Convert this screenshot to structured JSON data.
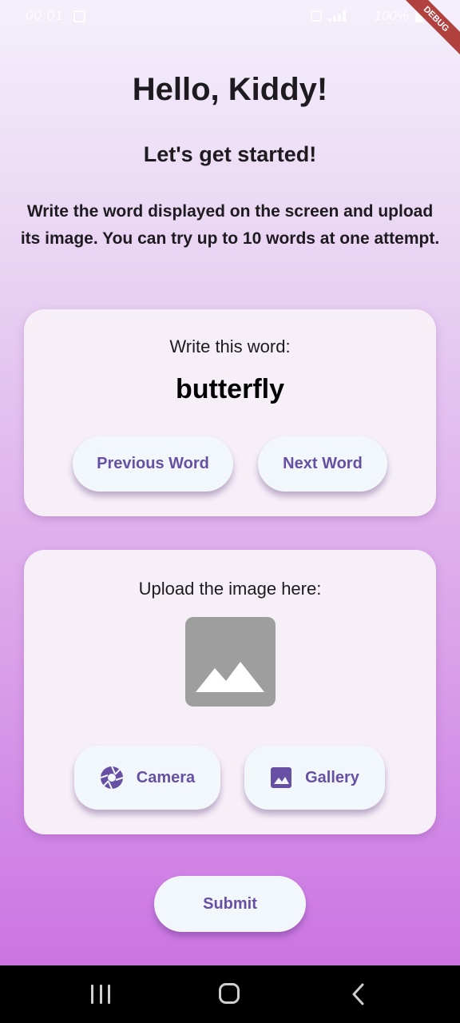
{
  "status_bar": {
    "time": "00:01",
    "battery": "100%",
    "debug_label": "DEBUG"
  },
  "header": {
    "title": "Hello, Kiddy!",
    "subtitle": "Let's get started!",
    "instructions": "Write the word displayed on the screen and upload its image. You can try up to 10 words at one attempt."
  },
  "word_card": {
    "label": "Write this word:",
    "word": "butterfly",
    "previous_label": "Previous Word",
    "next_label": "Next Word"
  },
  "upload_card": {
    "label": "Upload the image here:",
    "placeholder_icon": "image-placeholder-icon",
    "camera_label": "Camera",
    "camera_icon": "camera-shutter-icon",
    "gallery_label": "Gallery",
    "gallery_icon": "gallery-icon"
  },
  "submit_label": "Submit",
  "colors": {
    "accent": "#6750a4",
    "button_bg": "#f1f7fb",
    "card_bg": "#f6eff8",
    "placeholder_gray": "#9e9e9e",
    "gradient_top": "#f4f0fb",
    "gradient_bottom": "#c86ce2"
  }
}
